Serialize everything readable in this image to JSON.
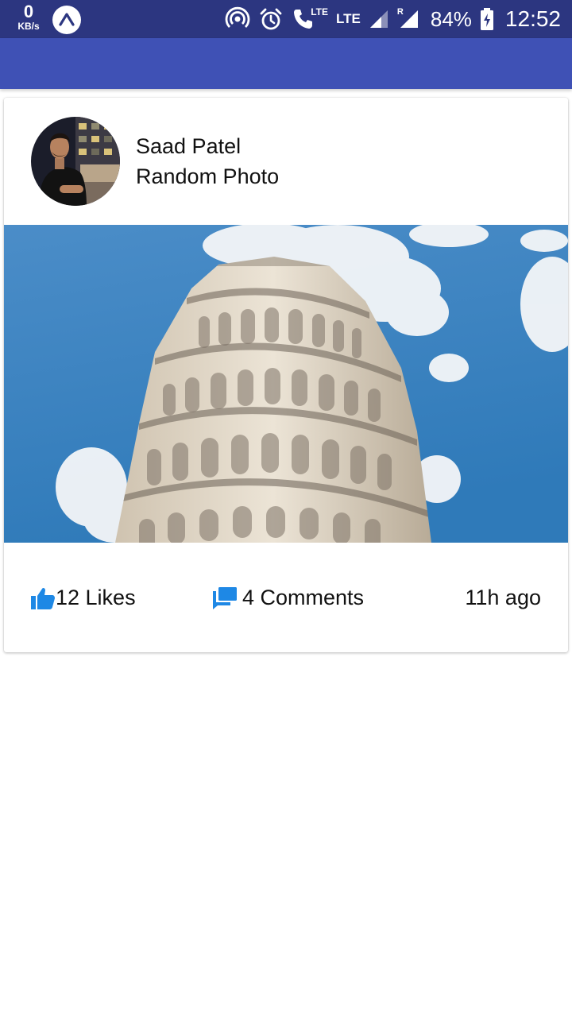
{
  "status_bar": {
    "net_speed_value": "0",
    "net_speed_unit": "KB/s",
    "lte_1": "LTE",
    "lte_2": "LTE",
    "roaming": "R",
    "battery": "84%",
    "time": "12:52",
    "icons": [
      "expo-icon",
      "hotspot-icon",
      "alarm-icon",
      "volte-call-icon",
      "signal-icon",
      "roaming-signal-icon",
      "battery-charging-icon"
    ]
  },
  "app_bar": {
    "color": "#3f51b5"
  },
  "post": {
    "author": "Saad Patel",
    "caption": "Random Photo",
    "likes_label": "12 Likes",
    "comments_label": "4 Comments",
    "time_label": "11h ago",
    "accent": "#1e88e5"
  }
}
